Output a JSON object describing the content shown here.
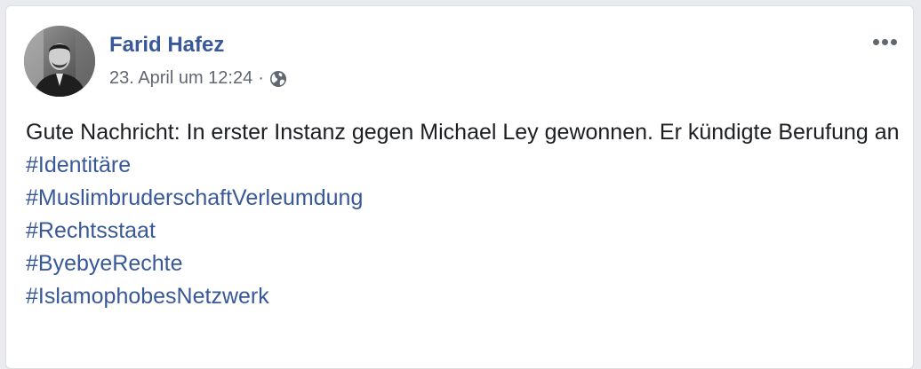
{
  "post": {
    "author": "Farid Hafez",
    "date": "23. April um 12:24",
    "separator": "·",
    "privacy_icon": "globe-icon",
    "more_icon": "more-options-icon",
    "avatar_icon": "profile-photo",
    "text": "Gute Nachricht: In erster Instanz gegen Michael Ley gewonnen. Er kündigte Berufung an",
    "hashtags": [
      "#Identitäre",
      "#MuslimbruderschaftVerleumdung",
      "#Rechtsstaat",
      "#ByebyeRechte",
      "#IslamophobesNetzwerk"
    ]
  },
  "colors": {
    "link": "#385898",
    "text": "#1c1e21",
    "meta": "#616770",
    "background": "#e9ebee",
    "card": "#ffffff"
  }
}
